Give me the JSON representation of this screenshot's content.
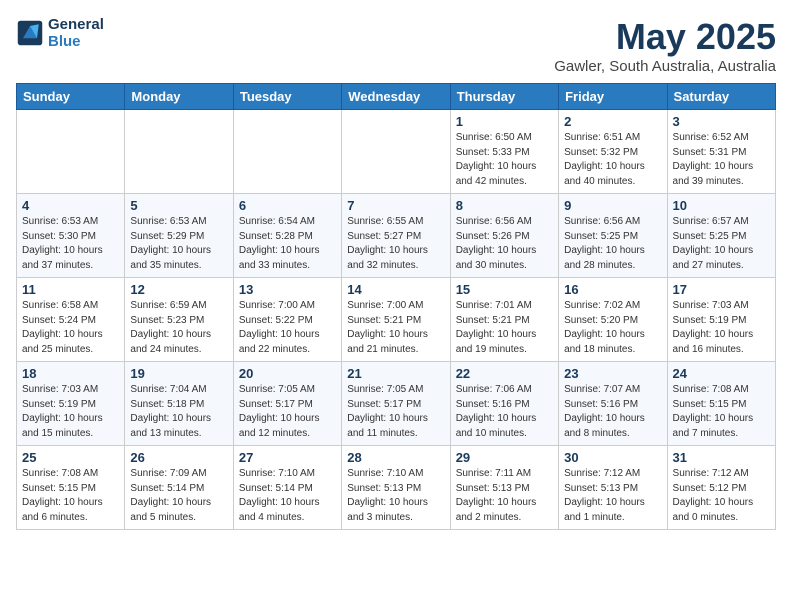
{
  "header": {
    "logo_line1": "General",
    "logo_line2": "Blue",
    "month": "May 2025",
    "location": "Gawler, South Australia, Australia"
  },
  "weekdays": [
    "Sunday",
    "Monday",
    "Tuesday",
    "Wednesday",
    "Thursday",
    "Friday",
    "Saturday"
  ],
  "weeks": [
    [
      {
        "day": "",
        "info": ""
      },
      {
        "day": "",
        "info": ""
      },
      {
        "day": "",
        "info": ""
      },
      {
        "day": "",
        "info": ""
      },
      {
        "day": "1",
        "info": "Sunrise: 6:50 AM\nSunset: 5:33 PM\nDaylight: 10 hours\nand 42 minutes."
      },
      {
        "day": "2",
        "info": "Sunrise: 6:51 AM\nSunset: 5:32 PM\nDaylight: 10 hours\nand 40 minutes."
      },
      {
        "day": "3",
        "info": "Sunrise: 6:52 AM\nSunset: 5:31 PM\nDaylight: 10 hours\nand 39 minutes."
      }
    ],
    [
      {
        "day": "4",
        "info": "Sunrise: 6:53 AM\nSunset: 5:30 PM\nDaylight: 10 hours\nand 37 minutes."
      },
      {
        "day": "5",
        "info": "Sunrise: 6:53 AM\nSunset: 5:29 PM\nDaylight: 10 hours\nand 35 minutes."
      },
      {
        "day": "6",
        "info": "Sunrise: 6:54 AM\nSunset: 5:28 PM\nDaylight: 10 hours\nand 33 minutes."
      },
      {
        "day": "7",
        "info": "Sunrise: 6:55 AM\nSunset: 5:27 PM\nDaylight: 10 hours\nand 32 minutes."
      },
      {
        "day": "8",
        "info": "Sunrise: 6:56 AM\nSunset: 5:26 PM\nDaylight: 10 hours\nand 30 minutes."
      },
      {
        "day": "9",
        "info": "Sunrise: 6:56 AM\nSunset: 5:25 PM\nDaylight: 10 hours\nand 28 minutes."
      },
      {
        "day": "10",
        "info": "Sunrise: 6:57 AM\nSunset: 5:25 PM\nDaylight: 10 hours\nand 27 minutes."
      }
    ],
    [
      {
        "day": "11",
        "info": "Sunrise: 6:58 AM\nSunset: 5:24 PM\nDaylight: 10 hours\nand 25 minutes."
      },
      {
        "day": "12",
        "info": "Sunrise: 6:59 AM\nSunset: 5:23 PM\nDaylight: 10 hours\nand 24 minutes."
      },
      {
        "day": "13",
        "info": "Sunrise: 7:00 AM\nSunset: 5:22 PM\nDaylight: 10 hours\nand 22 minutes."
      },
      {
        "day": "14",
        "info": "Sunrise: 7:00 AM\nSunset: 5:21 PM\nDaylight: 10 hours\nand 21 minutes."
      },
      {
        "day": "15",
        "info": "Sunrise: 7:01 AM\nSunset: 5:21 PM\nDaylight: 10 hours\nand 19 minutes."
      },
      {
        "day": "16",
        "info": "Sunrise: 7:02 AM\nSunset: 5:20 PM\nDaylight: 10 hours\nand 18 minutes."
      },
      {
        "day": "17",
        "info": "Sunrise: 7:03 AM\nSunset: 5:19 PM\nDaylight: 10 hours\nand 16 minutes."
      }
    ],
    [
      {
        "day": "18",
        "info": "Sunrise: 7:03 AM\nSunset: 5:19 PM\nDaylight: 10 hours\nand 15 minutes."
      },
      {
        "day": "19",
        "info": "Sunrise: 7:04 AM\nSunset: 5:18 PM\nDaylight: 10 hours\nand 13 minutes."
      },
      {
        "day": "20",
        "info": "Sunrise: 7:05 AM\nSunset: 5:17 PM\nDaylight: 10 hours\nand 12 minutes."
      },
      {
        "day": "21",
        "info": "Sunrise: 7:05 AM\nSunset: 5:17 PM\nDaylight: 10 hours\nand 11 minutes."
      },
      {
        "day": "22",
        "info": "Sunrise: 7:06 AM\nSunset: 5:16 PM\nDaylight: 10 hours\nand 10 minutes."
      },
      {
        "day": "23",
        "info": "Sunrise: 7:07 AM\nSunset: 5:16 PM\nDaylight: 10 hours\nand 8 minutes."
      },
      {
        "day": "24",
        "info": "Sunrise: 7:08 AM\nSunset: 5:15 PM\nDaylight: 10 hours\nand 7 minutes."
      }
    ],
    [
      {
        "day": "25",
        "info": "Sunrise: 7:08 AM\nSunset: 5:15 PM\nDaylight: 10 hours\nand 6 minutes."
      },
      {
        "day": "26",
        "info": "Sunrise: 7:09 AM\nSunset: 5:14 PM\nDaylight: 10 hours\nand 5 minutes."
      },
      {
        "day": "27",
        "info": "Sunrise: 7:10 AM\nSunset: 5:14 PM\nDaylight: 10 hours\nand 4 minutes."
      },
      {
        "day": "28",
        "info": "Sunrise: 7:10 AM\nSunset: 5:13 PM\nDaylight: 10 hours\nand 3 minutes."
      },
      {
        "day": "29",
        "info": "Sunrise: 7:11 AM\nSunset: 5:13 PM\nDaylight: 10 hours\nand 2 minutes."
      },
      {
        "day": "30",
        "info": "Sunrise: 7:12 AM\nSunset: 5:13 PM\nDaylight: 10 hours\nand 1 minute."
      },
      {
        "day": "31",
        "info": "Sunrise: 7:12 AM\nSunset: 5:12 PM\nDaylight: 10 hours\nand 0 minutes."
      }
    ]
  ]
}
